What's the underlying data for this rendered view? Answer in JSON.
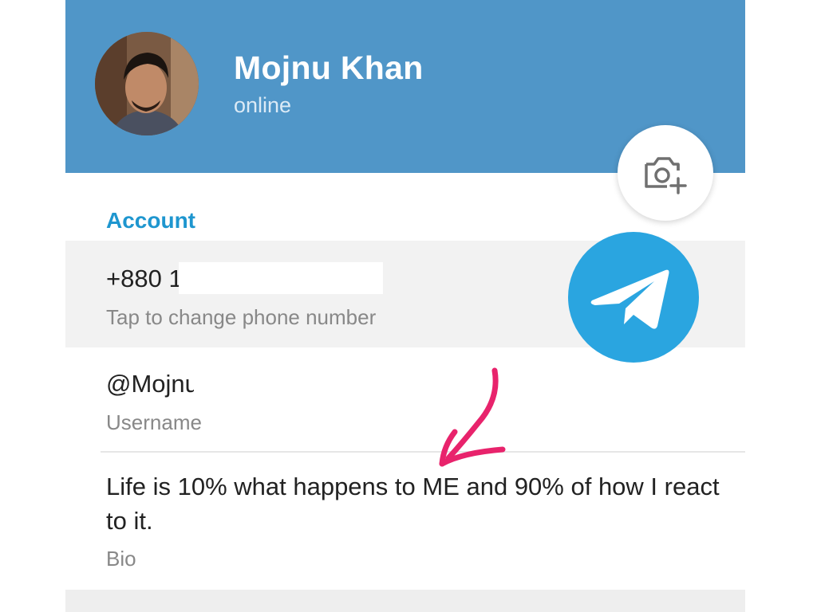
{
  "profile": {
    "name": "Mojnu Khan",
    "status": "online",
    "avatar_icon": "avatar-photo"
  },
  "account": {
    "section_title": "Account",
    "phone_value": "+880 1",
    "phone_hint": "Tap to change phone number",
    "username_value": "@Mojnu",
    "username_hint": "Username",
    "bio_value": "Life is 10% what happens to ME and 90% of how I react to it.",
    "bio_hint": "Bio"
  },
  "icons": {
    "camera": "camera-add-icon",
    "logo": "telegram-logo",
    "annotation": "pink-arrow-annotation"
  },
  "colors": {
    "header": "#5096c8",
    "accent": "#1e96cf",
    "telegram": "#2aa5e0",
    "annotation": "#e8236c"
  }
}
